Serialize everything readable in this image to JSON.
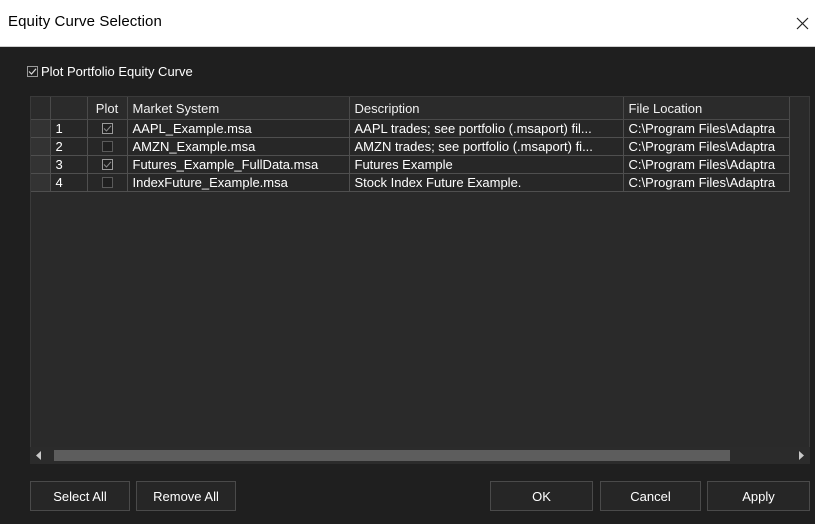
{
  "window": {
    "title": "Equity Curve Selection"
  },
  "options": {
    "plot_portfolio_label": "Plot Portfolio Equity Curve",
    "plot_portfolio_checked": true
  },
  "grid": {
    "columns": [
      "Plot",
      "Market System",
      "Description",
      "File Location"
    ],
    "rows": [
      {
        "num": "1",
        "plot": true,
        "system": "AAPL_Example.msa",
        "description": "AAPL trades; see portfolio (.msaport) fil...",
        "location": "C:\\Program Files\\Adaptra"
      },
      {
        "num": "2",
        "plot": false,
        "system": "AMZN_Example.msa",
        "description": "AMZN trades; see portfolio (.msaport) fi...",
        "location": "C:\\Program Files\\Adaptra"
      },
      {
        "num": "3",
        "plot": true,
        "system": "Futures_Example_FullData.msa",
        "description": "Futures Example",
        "location": "C:\\Program Files\\Adaptra"
      },
      {
        "num": "4",
        "plot": false,
        "system": "IndexFuture_Example.msa",
        "description": "Stock Index Future Example.",
        "location": "C:\\Program Files\\Adaptra"
      }
    ]
  },
  "buttons": {
    "select_all": "Select All",
    "remove_all": "Remove All",
    "ok": "OK",
    "cancel": "Cancel",
    "apply": "Apply"
  }
}
